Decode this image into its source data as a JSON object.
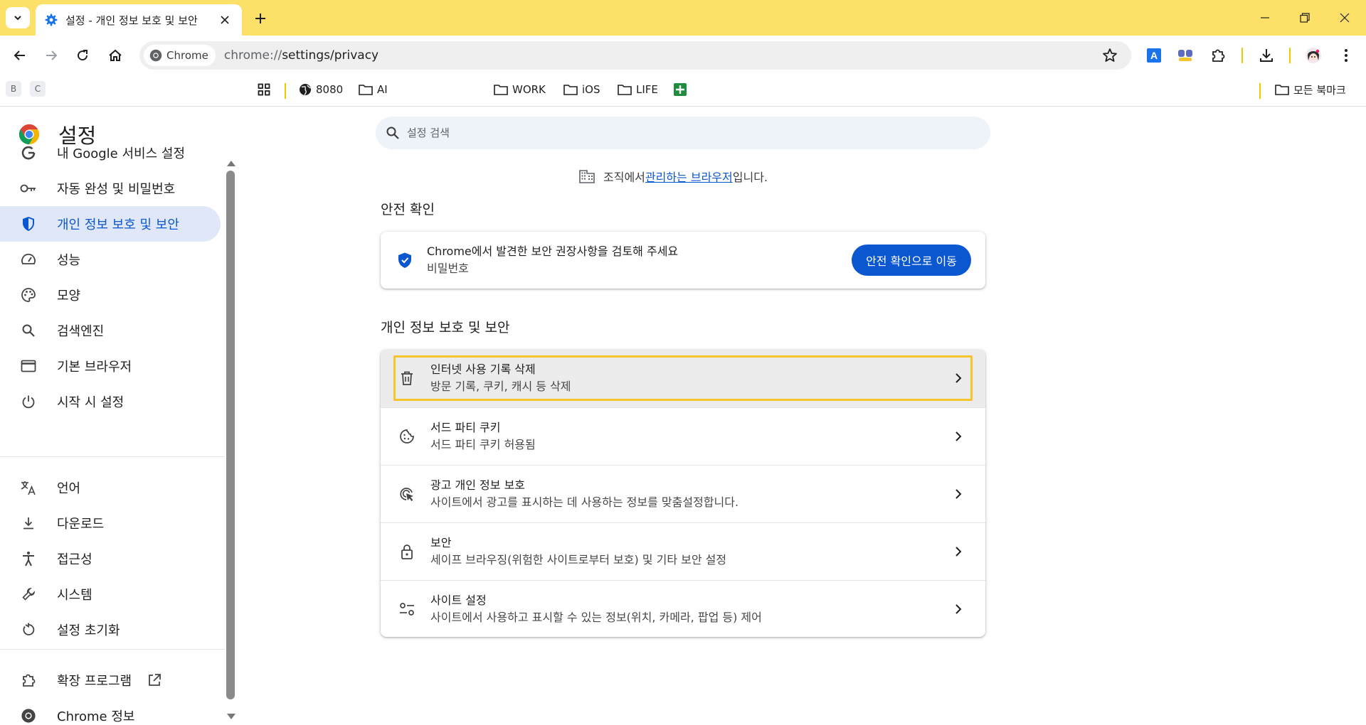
{
  "tab": {
    "title": "설정 - 개인 정보 보호 및 보안"
  },
  "omnibox": {
    "chip_label": "Chrome",
    "url_scheme": "chrome://",
    "url_path": "settings/privacy"
  },
  "bookmarks": {
    "mini_b": "B",
    "mini_c": "C",
    "item_8080": "8080",
    "item_ai": "AI",
    "item_work": "WORK",
    "item_ios": "iOS",
    "item_life": "LIFE",
    "all_bookmarks": "모든 북마크"
  },
  "sidebar": {
    "title": "설정",
    "items": [
      {
        "label": "내 Google 서비스 설정",
        "icon": "google-g-icon"
      },
      {
        "label": "자동 완성 및 비밀번호",
        "icon": "key-icon"
      },
      {
        "label": "개인 정보 보호 및 보안",
        "icon": "shield-icon",
        "active": true
      },
      {
        "label": "성능",
        "icon": "speedometer-icon"
      },
      {
        "label": "모양",
        "icon": "palette-icon"
      },
      {
        "label": "검색엔진",
        "icon": "search-icon"
      },
      {
        "label": "기본 브라우저",
        "icon": "browser-window-icon"
      },
      {
        "label": "시작 시 설정",
        "icon": "power-icon"
      },
      {
        "label": "언어",
        "icon": "translate-icon"
      },
      {
        "label": "다운로드",
        "icon": "download-icon"
      },
      {
        "label": "접근성",
        "icon": "accessibility-icon"
      },
      {
        "label": "시스템",
        "icon": "wrench-icon"
      },
      {
        "label": "설정 초기화",
        "icon": "reset-icon"
      },
      {
        "label": "확장 프로그램",
        "icon": "extension-icon"
      },
      {
        "label": "Chrome 정보",
        "icon": "chrome-logo-icon"
      }
    ]
  },
  "search": {
    "placeholder": "설정 검색"
  },
  "managed": {
    "prefix": "조직에서 ",
    "link": "관리하는 브라우저",
    "suffix": "입니다."
  },
  "safety_check": {
    "section_title": "안전 확인",
    "title": "Chrome에서 발견한 보안 권장사항을 검토해 주세요",
    "subtitle": "비밀번호",
    "button": "안전 확인으로 이동"
  },
  "privacy": {
    "section_title": "개인 정보 보호 및 보안",
    "rows": [
      {
        "title": "인터넷 사용 기록 삭제",
        "subtitle": "방문 기록, 쿠키, 캐시 등 삭제",
        "icon": "trash-icon"
      },
      {
        "title": "서드 파티 쿠키",
        "subtitle": "서드 파티 쿠키 허용됨",
        "icon": "cookie-icon"
      },
      {
        "title": "광고 개인 정보 보호",
        "subtitle": "사이트에서 광고를 표시하는 데 사용하는 정보를 맞춤설정합니다.",
        "icon": "ad-privacy-icon"
      },
      {
        "title": "보안",
        "subtitle": "세이프 브라우징(위험한 사이트로부터 보호) 및 기타 보안 설정",
        "icon": "lock-icon"
      },
      {
        "title": "사이트 설정",
        "subtitle": "사이트에서 사용하고 표시할 수 있는 정보(위치, 카메라, 팝업 등) 제어",
        "icon": "tune-icon"
      }
    ]
  },
  "colors": {
    "tabstrip": "#fde068",
    "accent": "#0b57d0",
    "active_nav_bg": "#dfe7f8",
    "focus_ring": "#f7c52a"
  }
}
